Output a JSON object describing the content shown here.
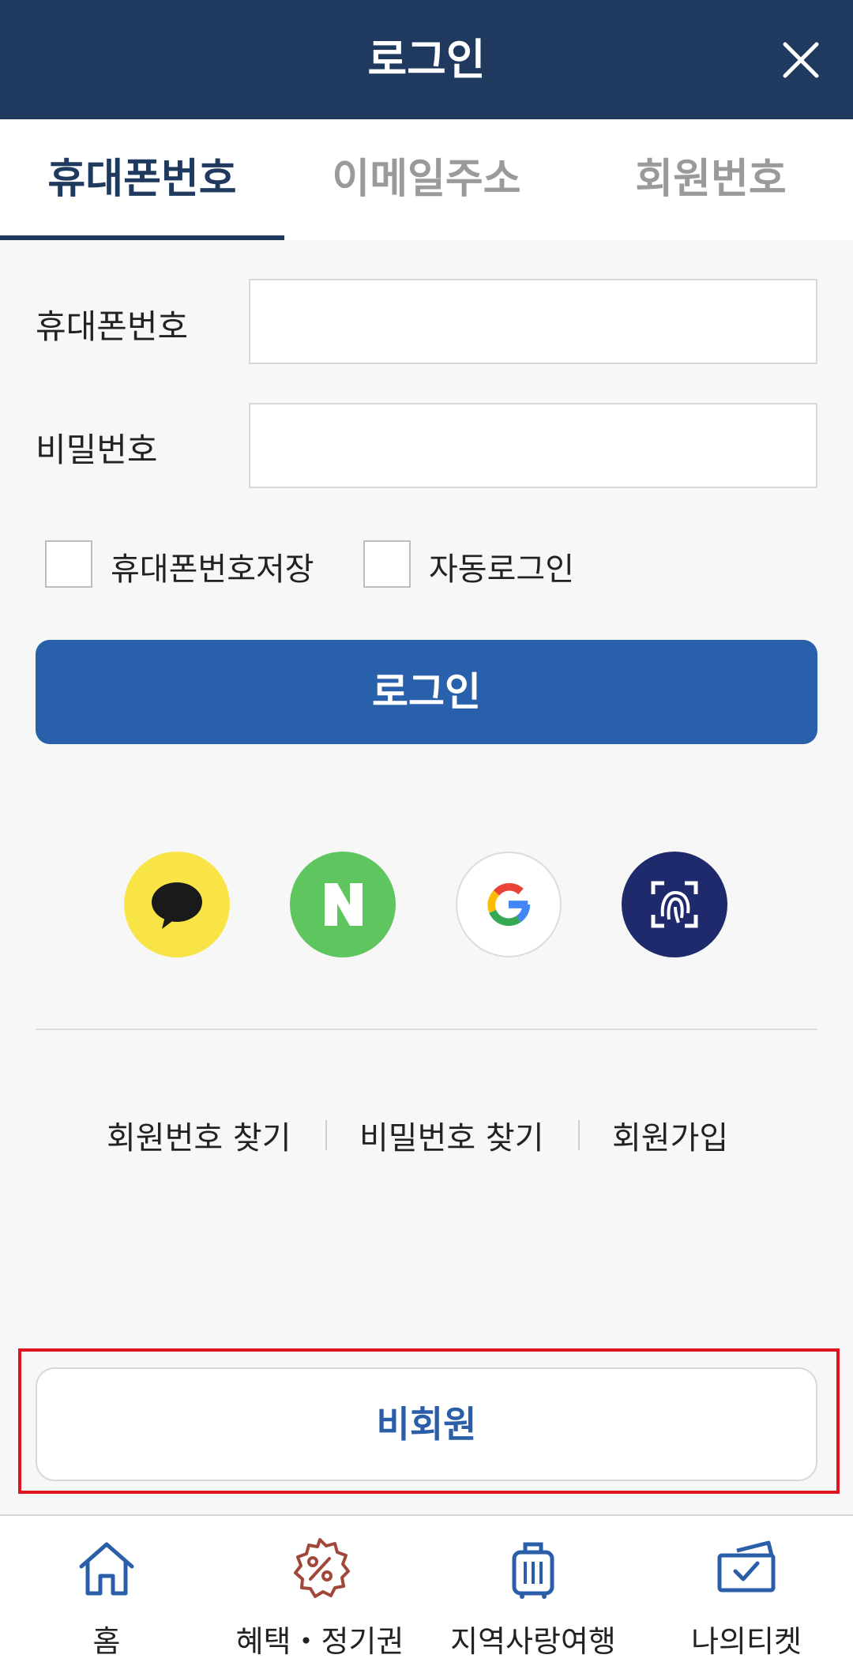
{
  "header": {
    "title": "로그인"
  },
  "tabs": [
    {
      "label": "휴대폰번호",
      "active": true
    },
    {
      "label": "이메일주소",
      "active": false
    },
    {
      "label": "회원번호",
      "active": false
    }
  ],
  "form": {
    "phone_label": "휴대폰번호",
    "phone_value": "",
    "password_label": "비밀번호",
    "password_value": "",
    "save_phone_label": "휴대폰번호저장",
    "auto_login_label": "자동로그인",
    "login_button": "로그인"
  },
  "social": [
    "kakao-icon",
    "naver-icon",
    "google-icon",
    "fingerprint-icon"
  ],
  "links": {
    "find_member_no": "회원번호 찾기",
    "find_password": "비밀번호 찾기",
    "signup": "회원가입"
  },
  "guest_button": "비회원",
  "bottom_nav": [
    {
      "label": "홈",
      "icon": "home-icon"
    },
    {
      "label": "혜택・정기권",
      "icon": "discount-badge-icon"
    },
    {
      "label": "지역사랑여행",
      "icon": "suitcase-icon"
    },
    {
      "label": "나의티켓",
      "icon": "ticket-icon"
    }
  ],
  "colors": {
    "header": "#1f3a5e",
    "primary": "#2860ab",
    "highlight": "#e0141e",
    "kakao": "#f8e447",
    "naver": "#5ec55f",
    "biometric": "#1f2a6d"
  }
}
